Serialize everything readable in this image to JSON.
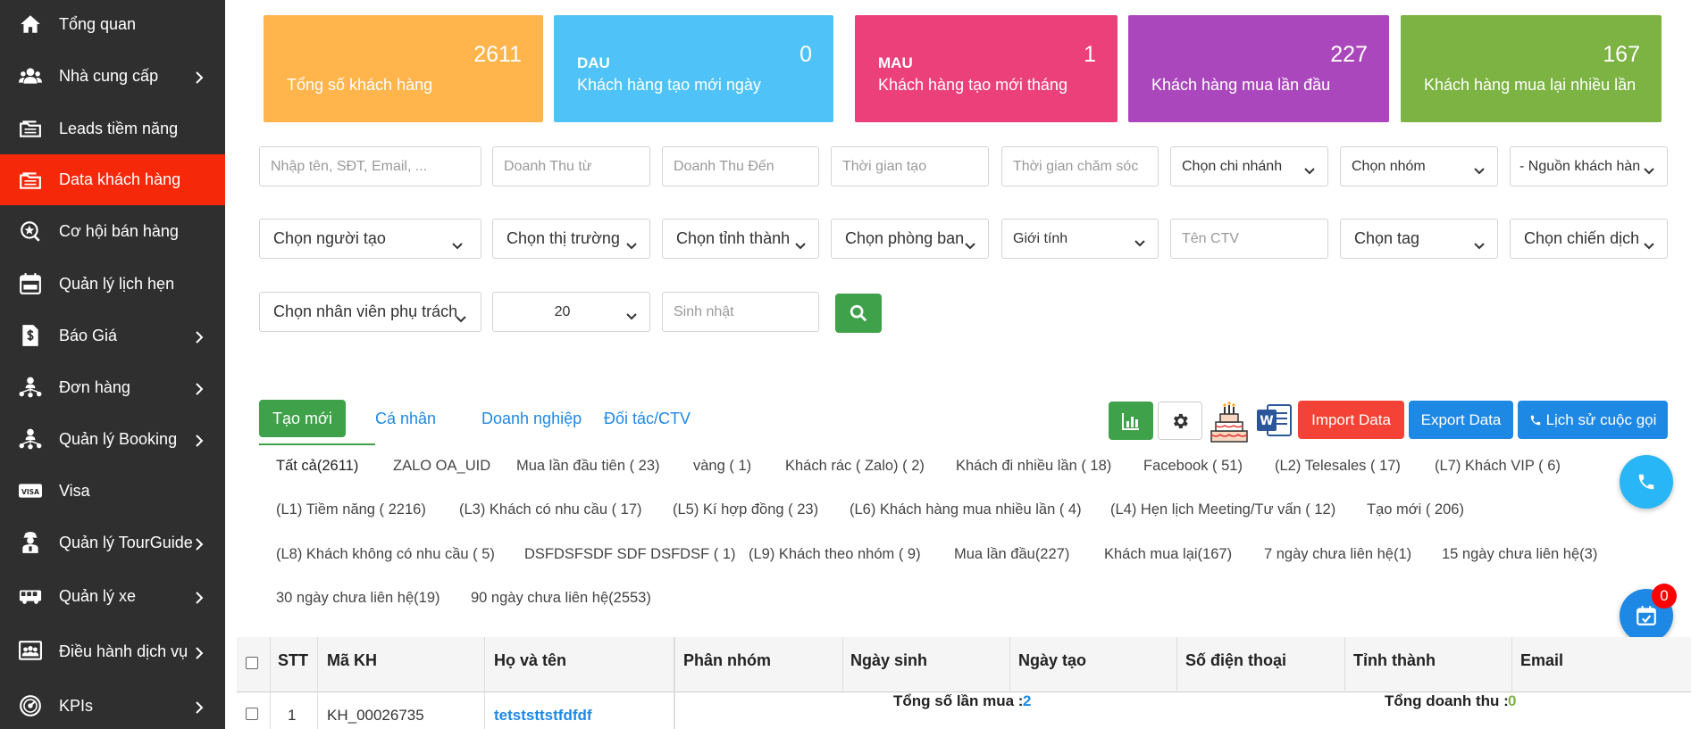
{
  "sidebar": {
    "items": [
      {
        "label": "Tổng quan"
      },
      {
        "label": "Nhà cung cấp"
      },
      {
        "label": "Leads tiềm năng"
      },
      {
        "label": "Data khách hàng"
      },
      {
        "label": "Cơ hội bán hàng"
      },
      {
        "label": "Quản lý lịch hẹn"
      },
      {
        "label": "Báo Giá"
      },
      {
        "label": "Đơn hàng"
      },
      {
        "label": "Quản lý Booking"
      },
      {
        "label": "Visa"
      },
      {
        "label": "Quản lý TourGuide"
      },
      {
        "label": "Quản lý xe"
      },
      {
        "label": "Điều hành dịch vụ"
      },
      {
        "label": "KPIs"
      }
    ],
    "active_color": "#f5280a",
    "bg_color": "#2f2f2f"
  },
  "stats": [
    {
      "title": "",
      "value": "2611",
      "desc": "Tổng số khách hàng",
      "color": "#ffb44c"
    },
    {
      "title": "DAU",
      "value": "0",
      "desc": "Khách hàng tạo mới ngày",
      "color": "#4fc3f7"
    },
    {
      "title": "MAU",
      "value": "1",
      "desc": "Khách hàng tạo mới tháng",
      "color": "#ec407a"
    },
    {
      "title": "",
      "value": "227",
      "desc": "Khách hàng mua lần đầu",
      "color": "#ab47bc"
    },
    {
      "title": "",
      "value": "167",
      "desc": "Khách hàng mua lại nhiều lần",
      "color": "#7cb342"
    }
  ],
  "filters": {
    "row1": {
      "search_placeholder": "Nhập tên, SĐT, Email, ...",
      "revenue_from_placeholder": "Doanh Thu từ",
      "revenue_to_placeholder": "Doanh Thu Đến",
      "created_time_placeholder": "Thời gian tạo",
      "care_time_placeholder": "Thời gian chăm sóc",
      "branch": "Chọn chi nhánh",
      "group": "Chọn nhóm",
      "source": "- Nguồn khách hàn"
    },
    "row2": {
      "creator": "Chọn người tạo",
      "market": "Chọn thị trường",
      "province": "Chọn tỉnh thành",
      "department": "Chọn phòng ban",
      "gender": "Giới tính",
      "ctv_placeholder": "Tên CTV",
      "tag": "Chọn tag",
      "campaign": "Chọn chiến dịch"
    },
    "row3": {
      "staff": "Chọn nhân viên phụ trách",
      "page_size": "20",
      "birthday_placeholder": "Sinh nhật"
    }
  },
  "tabs": [
    {
      "label": "Tạo mới"
    },
    {
      "label": "Cá nhân"
    },
    {
      "label": "Doanh nghiệp"
    },
    {
      "label": "Đối tác/CTV"
    }
  ],
  "actions": {
    "import": "Import Data",
    "export": "Export Data",
    "call_history": "Lịch sử cuộc gọi",
    "import_color": "#f44336",
    "export_color": "#1e88e5"
  },
  "chips": [
    "Tất cả(2611)",
    "ZALO OA_UID",
    "Mua lần đầu tiên ( 23)",
    "vàng ( 1)",
    "Khách rác ( Zalo) ( 2)",
    "Khách đi nhiều lần ( 18)",
    "Facebook ( 51)",
    "(L2) Telesales ( 17)",
    "(L7) Khách VIP ( 6)",
    "(L1) Tiềm năng ( 2216)",
    "(L3) Khách có nhu cầu ( 17)",
    "(L5) Kí hợp đồng ( 23)",
    "(L6) Khách hàng mua nhiều lần ( 4)",
    "(L4) Hẹn lịch Meeting/Tư vấn ( 12)",
    "Tạo mới ( 206)",
    "(L8) Khách không có nhu cầu ( 5)",
    "DSFDSFSDF SDF DSFDSF ( 1)",
    "(L9) Khách theo nhóm ( 9)",
    "Mua lần đầu(227)",
    "Khách mua lại(167)",
    "7 ngày chưa liên hệ(1)",
    "15 ngày chưa liên hệ(3)",
    "30 ngày chưa liên hệ(19)",
    "90 ngày chưa liên hệ(2553)"
  ],
  "table": {
    "headers": [
      "STT",
      "Mã KH",
      "Họ và tên",
      "Phân nhóm",
      "Ngày sinh",
      "Ngày tạo",
      "Số điện thoại",
      "Tỉnh thành",
      "Email"
    ],
    "rows": [
      {
        "stt": "1",
        "code": "KH_00026735",
        "name": "tetststtstfdfdf"
      }
    ],
    "summary": {
      "purchase_label": "Tổng số lần mua :",
      "purchase_value": "2",
      "revenue_label": "Tổng doanh thu :",
      "revenue_value": "0"
    }
  },
  "notifications": {
    "calendar_badge": "0"
  }
}
